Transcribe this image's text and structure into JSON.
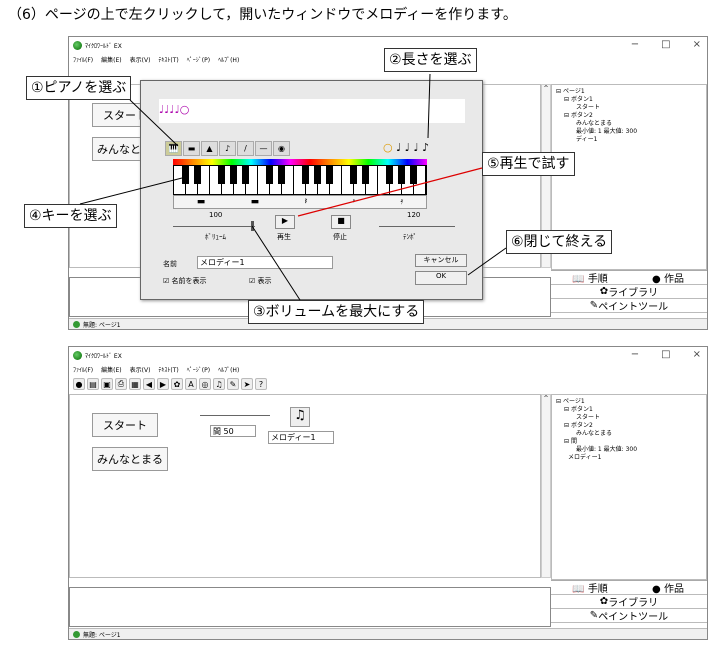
{
  "heading": "（6）ページの上で左クリックして，開いたウィンドウでメロディーを作ります。",
  "app": {
    "title": "ﾏｲｸﾛﾜｰﾙﾄﾞ EX",
    "window_controls": [
      "−",
      "□",
      "×"
    ],
    "menus": [
      "ﾌｧｲﾙ(F)",
      "編集(E)",
      "表示(V)",
      "ﾃｷｽﾄ(T)",
      "ﾍﾟｰｼﾞ(P)",
      "ﾍﾙﾌﾟ(H)"
    ],
    "status": "無題: ページ1"
  },
  "page_buttons": {
    "start": "スタート",
    "minna": "みんなとまる"
  },
  "tree1": [
    "ページ1",
    "ボタン1",
    "スタート",
    "ボタン2",
    "みんなとまる",
    "最小値: 1 最大値: 300",
    "ディー1"
  ],
  "tree2": [
    "ページ1",
    "ボタン1",
    "スタート",
    "ボタン2",
    "みんなとまる",
    "間",
    "最小値: 1 最大値: 300",
    "メロディー1"
  ],
  "tabs": {
    "tejun": "手順",
    "sakuhin": "作品",
    "library": "ライブラリ",
    "paint": "ペイントツール"
  },
  "dialog": {
    "volume_value": "100",
    "volume_label": "ﾎﾞﾘｭｰﾑ",
    "play_label": "再生",
    "stop_label": "停止",
    "tempo_value": "120",
    "tempo_label": "ﾃﾝﾎﾟ",
    "name_label": "名前",
    "name_value": "メロディー1",
    "show_name": "名前を表示",
    "show": "表示",
    "cancel": "キャンセル",
    "ok": "OK"
  },
  "annotations": {
    "a1": "①ピアノを選ぶ",
    "a2": "②長さを選ぶ",
    "a3": "③ボリュームを最大にする",
    "a4": "④キーを選ぶ",
    "a5": "⑤再生で試す",
    "a6": "⑥閉じて終える"
  },
  "slider2": {
    "label": "間",
    "value": "50"
  },
  "melody_label": "メロディー1"
}
